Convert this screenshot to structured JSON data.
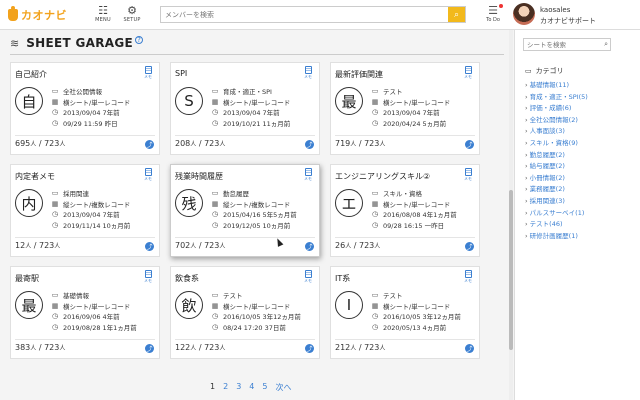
{
  "header": {
    "logo_text": "カオナビ",
    "nav": [
      {
        "name": "menu",
        "label": "MENU",
        "glyph": "☷"
      },
      {
        "name": "setup",
        "label": "SETUP",
        "glyph": "⚙"
      }
    ],
    "search_placeholder": "メンバーを検索",
    "todo_label": "To Do",
    "user_name": "kaosales",
    "user_org": "カオナビサポート"
  },
  "page": {
    "title": "SHEET GARAGE",
    "help": "?"
  },
  "memo_label": "メモ",
  "count_unit": "人",
  "cards": [
    {
      "title": "自己紹介",
      "kanji": "自",
      "lines": [
        "全社公開情報",
        "横シート/単一レコード",
        "2013/09/04 7年前",
        "09/29 11:59 昨日"
      ],
      "count": "695",
      "total": "723"
    },
    {
      "title": "SPI",
      "kanji": "S",
      "lines": [
        "育成・適正・SPI",
        "横シート/単一レコード",
        "2013/09/04 7年前",
        "2019/10/21 11ヵ月前"
      ],
      "count": "208",
      "total": "723"
    },
    {
      "title": "最新評価関連",
      "kanji": "最",
      "lines": [
        "テスト",
        "横シート/単一レコード",
        "2013/09/04 7年前",
        "2020/04/24 5ヵ月前"
      ],
      "count": "719",
      "total": "723"
    },
    {
      "title": "内定者メモ",
      "kanji": "内",
      "lines": [
        "採用関連",
        "縦シート/複数レコード",
        "2013/09/04 7年前",
        "2019/11/14 10ヵ月前"
      ],
      "count": "12",
      "total": "723"
    },
    {
      "title": "残業時間履歴",
      "kanji": "残",
      "lines": [
        "勤怠履歴",
        "縦シート/複数レコード",
        "2015/04/16 5年5ヵ月前",
        "2019/12/05 10ヵ月前"
      ],
      "count": "702",
      "total": "723"
    },
    {
      "title": "エンジニアリングスキル②",
      "kanji": "エ",
      "lines": [
        "スキル・資格",
        "横シート/単一レコード",
        "2016/08/08 4年1ヵ月前",
        "09/28 16:15 一昨日"
      ],
      "count": "26",
      "total": "723"
    },
    {
      "title": "最寄駅",
      "kanji": "最",
      "lines": [
        "基礎情報",
        "横シート/単一レコード",
        "2016/09/06 4年前",
        "2019/08/28 1年1ヵ月前"
      ],
      "count": "383",
      "total": "723"
    },
    {
      "title": "飲食系",
      "kanji": "飲",
      "lines": [
        "テスト",
        "横シート/単一レコード",
        "2016/10/05 3年12ヵ月前",
        "08/24 17:20 37日前"
      ],
      "count": "122",
      "total": "723"
    },
    {
      "title": "IT系",
      "kanji": "I",
      "lines": [
        "テスト",
        "横シート/単一レコード",
        "2016/10/05 3年12ヵ月前",
        "2020/05/13 4ヵ月前"
      ],
      "count": "212",
      "total": "723"
    }
  ],
  "pagination": [
    "1",
    "2",
    "3",
    "4",
    "5",
    "次へ"
  ],
  "sidebar": {
    "search_placeholder": "シートを検索",
    "category_heading": "カテゴリ",
    "categories": [
      "基礎情報(11)",
      "育成・適正・SPI(5)",
      "評価・成績(6)",
      "全社公開情報(2)",
      "人事面談(3)",
      "スキル・資格(9)",
      "勤怠履歴(2)",
      "給与履歴(2)",
      "小冊情報(2)",
      "業務履歴(2)",
      "採用関連(3)",
      "パルスサーベイ(1)",
      "テスト(46)",
      "研修計画履歴(1)"
    ]
  },
  "colors": {
    "accent": "#f2a21c",
    "link": "#3b7fd1",
    "search_button": "#f2b91c"
  }
}
